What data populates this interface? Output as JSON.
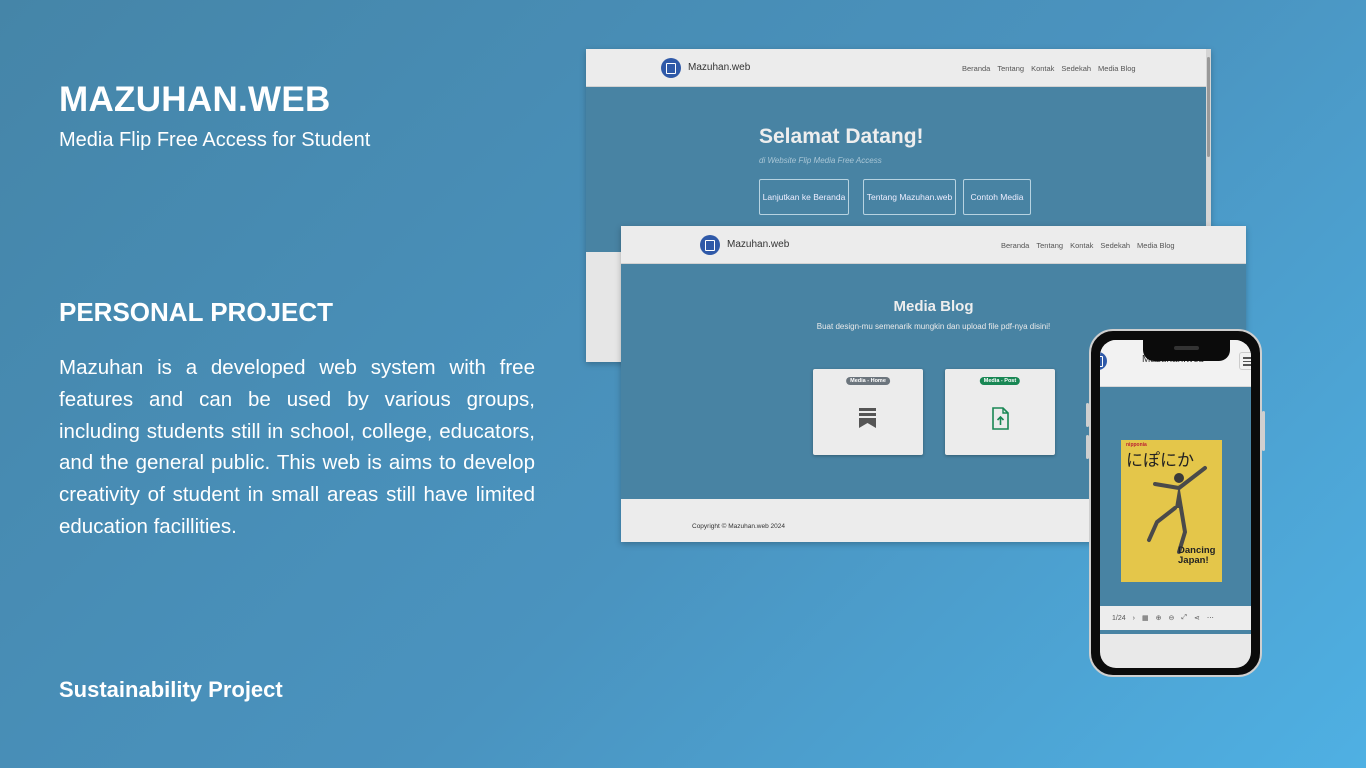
{
  "left": {
    "title": "MAZUHAN.WEB",
    "subtitle": "Media Flip Free Access for Student",
    "section_title": "PERSONAL PROJECT",
    "description": "Mazuhan is a developed web system with free features and can be used by various groups, including students still in school, college, educators, and the general public. This web is aims to develop creativity of student in small areas still have limited education facillities.",
    "footer_label": "Sustainability Project"
  },
  "site": {
    "brand": "Mazuhan.web",
    "nav": [
      "Beranda",
      "Tentang",
      "Kontak",
      "Sedekah",
      "Media Blog"
    ]
  },
  "landing": {
    "heading": "Selamat Datang!",
    "subheading": "di Website Flip Media Free Access",
    "buttons": [
      "Lanjutkan ke Beranda",
      "Tentang Mazuhan.web",
      "Contoh Media"
    ]
  },
  "blog": {
    "heading": "Media Blog",
    "subheading": "Buat design-mu semenarik mungkin dan upload file pdf-nya disini!",
    "cards": [
      {
        "badge": "Media - Home",
        "icon": "bookmark-icon",
        "badge_color": "#6c757d"
      },
      {
        "badge": "Media - Post",
        "icon": "file-upload-icon",
        "badge_color": "#198754"
      }
    ],
    "copyright": "Copyright © Mazuhan.web 2024"
  },
  "phone": {
    "brand": "Mazuhan.web",
    "magazine": {
      "masthead": "nipponia",
      "title_jp": "にぽにか",
      "headline_line1": "Dancing",
      "headline_line2": "Japan!"
    },
    "page_indicator": "1/24"
  },
  "colors": {
    "hero": "#4883a3",
    "brand_logo": "#2f59a8"
  }
}
